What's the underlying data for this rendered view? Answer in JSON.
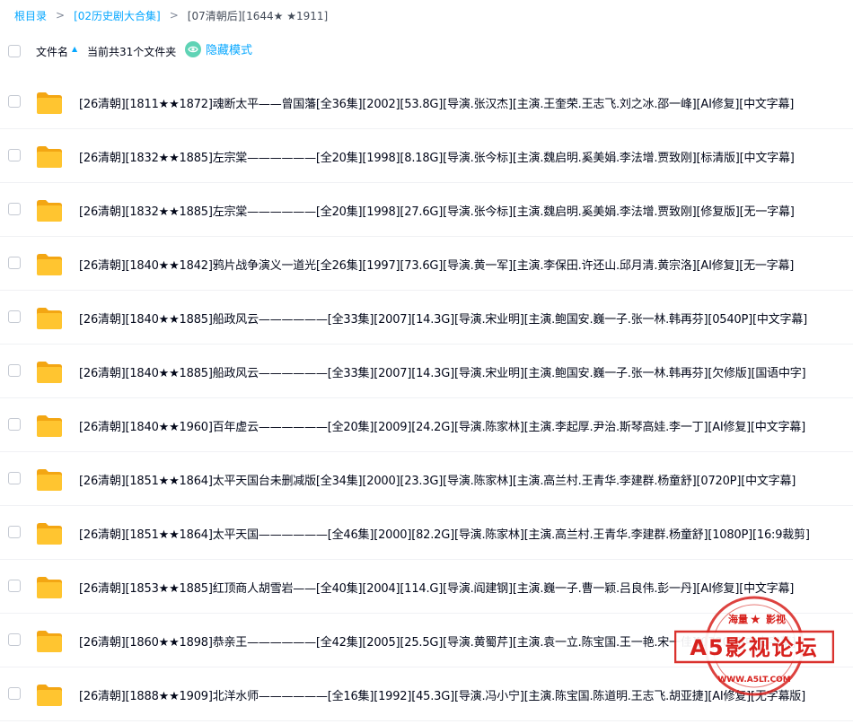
{
  "breadcrumb": {
    "root": "根目录",
    "parent": "[02历史剧大合集]",
    "current": "[07清朝后][1644★ ★1911]"
  },
  "list_header": {
    "sort_label": "文件名",
    "count_text": "当前共31个文件夹",
    "hidden_mode_label": "隐藏模式"
  },
  "files": [
    {
      "name": "[26清朝][1811★★1872]魂断太平——曾国藩[全36集][2002][53.8G][导演.张汉杰][主演.王奎荣.王志飞.刘之冰.邵一峰][AI修复][中文字幕]"
    },
    {
      "name": "[26清朝][1832★★1885]左宗棠——————[全20集][1998][8.18G][导演.张今标][主演.魏启明.奚美娟.李法增.贾致刚][标清版][中文字幕]"
    },
    {
      "name": "[26清朝][1832★★1885]左宗棠——————[全20集][1998][27.6G][导演.张今标][主演.魏启明.奚美娟.李法增.贾致刚][修复版][无一字幕]"
    },
    {
      "name": "[26清朝][1840★★1842]鸦片战争演义一道光[全26集][1997][73.6G][导演.黄一军][主演.李保田.许还山.邱月清.黄宗洛][AI修复][无一字幕]"
    },
    {
      "name": "[26清朝][1840★★1885]船政风云——————[全33集][2007][14.3G][导演.宋业明][主演.鲍国安.巍一子.张一林.韩再芬][0540P][中文字幕]"
    },
    {
      "name": "[26清朝][1840★★1885]船政风云——————[全33集][2007][14.3G][导演.宋业明][主演.鲍国安.巍一子.张一林.韩再芬][欠修版][国语中字]"
    },
    {
      "name": "[26清朝][1840★★1960]百年虚云——————[全20集][2009][24.2G][导演.陈家林][主演.李起厚.尹治.斯琴高娃.李一丁][AI修复][中文字幕]"
    },
    {
      "name": "[26清朝][1851★★1864]太平天国台未删减版[全34集][2000][23.3G][导演.陈家林][主演.高兰村.王青华.李建群.杨童舒][0720P][中文字幕]"
    },
    {
      "name": "[26清朝][1851★★1864]太平天国——————[全46集][2000][82.2G][导演.陈家林][主演.高兰村.王青华.李建群.杨童舒][1080P][16:9裁剪]"
    },
    {
      "name": "[26清朝][1853★★1885]红顶商人胡雪岩——[全40集][2004][114.G][导演.阎建钢][主演.巍一子.曹一颖.吕良伟.彭一丹][AI修复][中文字幕]"
    },
    {
      "name": "[26清朝][1860★★1898]恭亲王——————[全42集][2005][25.5G][导演.黄蜀芹][主演.袁一立.陈宝国.王一艳.宋一佳][0720P][中文字幕]"
    },
    {
      "name": "[26清朝][1888★★1909]北洋水师——————[全16集][1992][45.3G][导演.冯小宁][主演.陈宝国.陈道明.王志飞.胡亚捷][AI修复][无字幕版]"
    }
  ],
  "watermark": {
    "top_text": "海量",
    "top_text_right": "影视",
    "brand": "A5影视论坛",
    "url": "WWW.A5LT.COM"
  },
  "colors": {
    "accent": "#06a7ff",
    "folder": "#ffc530",
    "watermark_red": "#d7211d"
  }
}
